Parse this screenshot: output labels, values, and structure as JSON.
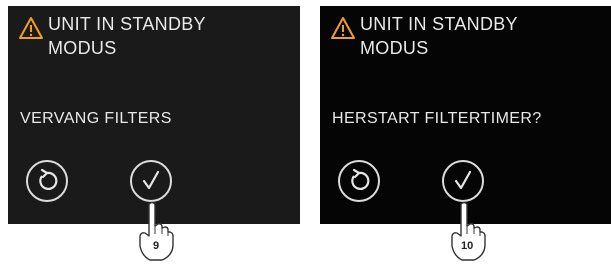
{
  "screens": [
    {
      "title_line1": "UNIT IN STANDBY",
      "title_line2": "MODUS",
      "message": "VERVANG FILTERS",
      "step": "9"
    },
    {
      "title_line1": "UNIT IN STANDBY",
      "title_line2": "MODUS",
      "message": "HERSTART  FILTERTIMER?",
      "step": "10"
    }
  ],
  "icons": {
    "warning": "warning-icon",
    "back": "back-arrow-icon",
    "confirm": "checkmark-icon",
    "hand": "pointing-hand-icon"
  },
  "colors": {
    "warning": "#f0a020",
    "screen_text": "#e9e9e9"
  }
}
